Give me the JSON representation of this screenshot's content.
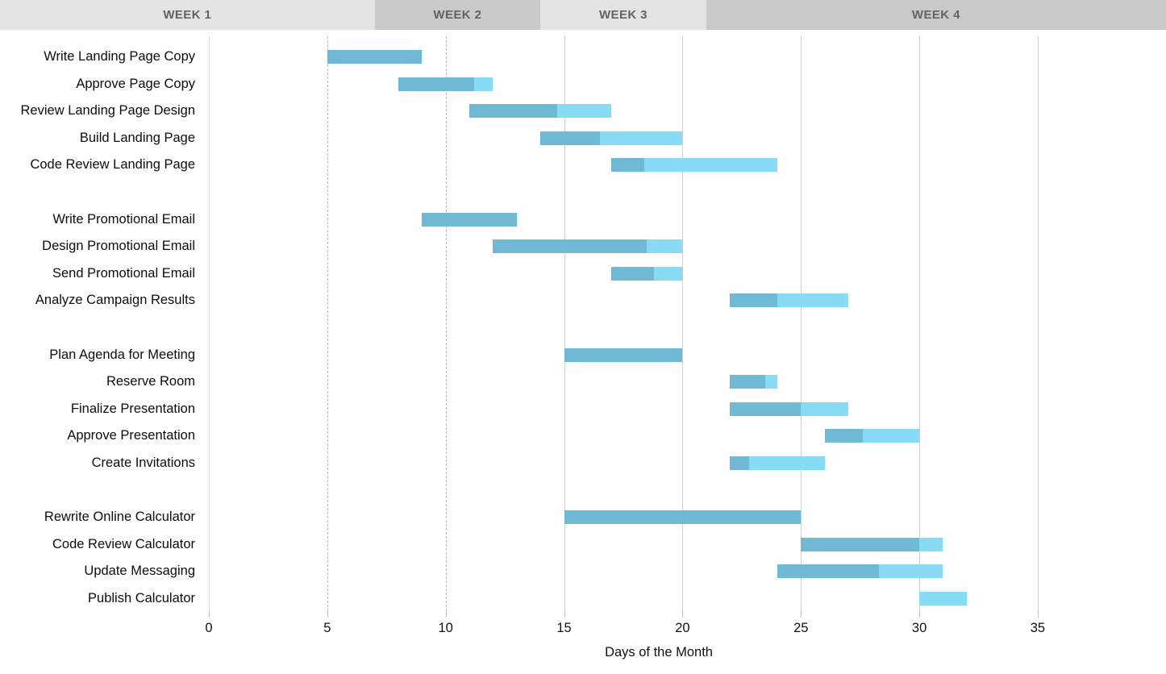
{
  "header": {
    "weeks": [
      {
        "label": "WEEK 1",
        "start_day": 0,
        "end_day": 7,
        "shade": "#e3e3e3"
      },
      {
        "label": "WEEK 2",
        "start_day": 7,
        "end_day": 14,
        "shade": "#c9c9c9"
      },
      {
        "label": "WEEK 3",
        "start_day": 14,
        "end_day": 21,
        "shade": "#e3e3e3"
      },
      {
        "label": "WEEK 4",
        "start_day": 21,
        "end_day": 28,
        "shade": "#c9c9c9"
      }
    ]
  },
  "axis": {
    "x_title": "Days of the Month",
    "x_ticks": [
      0,
      5,
      10,
      15,
      20,
      25,
      30,
      35
    ],
    "x_tick_labels": [
      "0",
      "5",
      "10",
      "15",
      "20",
      "25",
      "30",
      "35"
    ],
    "x_min": 0,
    "x_max": 38,
    "gridlines": [
      {
        "day": 5,
        "style": "dashed"
      },
      {
        "day": 10,
        "style": "dashed"
      },
      {
        "day": 15,
        "style": "solid"
      },
      {
        "day": 20,
        "style": "solid"
      },
      {
        "day": 25,
        "style": "solid"
      },
      {
        "day": 30,
        "style": "solid"
      },
      {
        "day": 35,
        "style": "solid"
      }
    ]
  },
  "colors": {
    "bar_complete": "#6FB9D4",
    "bar_remaining": "#87DBF5",
    "gridline_solid": "#d0d0d0",
    "gridline_dashed": "#bdbdbd",
    "header_band_light": "#e3e3e3",
    "header_band_dark": "#c9c9c9",
    "header_text": "#636363",
    "label_text": "#0d0d0d"
  },
  "chart_data": {
    "type": "bar",
    "title": "",
    "xlabel": "Days of the Month",
    "ylabel": "",
    "xlim": [
      0,
      38
    ],
    "grid": true,
    "legend": null,
    "orientation": "horizontal",
    "note": "Gantt chart: each task bar spans start->end in days of the month; the darker segment is elapsed/complete, the lighter segment is remaining.",
    "categories": [
      "Write Landing Page Copy",
      "Approve Page Copy",
      "Review Landing Page Design",
      "Build Landing Page",
      "Code Review Landing Page",
      "",
      "Write Promotional Email",
      "Design Promotional Email",
      "Send Promotional Email",
      "Analyze Campaign Results",
      "",
      "Plan Agenda for Meeting",
      "Reserve Room",
      "Finalize Presentation",
      "Approve Presentation",
      "Create Invitations",
      "",
      "Rewrite Online Calculator",
      "Code Review Calculator",
      "Update Messaging",
      "Publish Calculator"
    ],
    "tasks": [
      {
        "row": 0,
        "label": "Write Landing Page Copy",
        "start": 5,
        "complete_end": 9,
        "end": 9
      },
      {
        "row": 1,
        "label": "Approve Page Copy",
        "start": 8,
        "complete_end": 11.2,
        "end": 12
      },
      {
        "row": 2,
        "label": "Review Landing Page Design",
        "start": 11,
        "complete_end": 14.7,
        "end": 17
      },
      {
        "row": 3,
        "label": "Build Landing Page",
        "start": 14,
        "complete_end": 16.5,
        "end": 20
      },
      {
        "row": 4,
        "label": "Code Review Landing Page",
        "start": 17,
        "complete_end": 18.4,
        "end": 24
      },
      {
        "row": 6,
        "label": "Write Promotional Email",
        "start": 9,
        "complete_end": 13,
        "end": 13
      },
      {
        "row": 7,
        "label": "Design Promotional Email",
        "start": 12,
        "complete_end": 18.5,
        "end": 20
      },
      {
        "row": 8,
        "label": "Send Promotional Email",
        "start": 17,
        "complete_end": 18.8,
        "end": 20
      },
      {
        "row": 9,
        "label": "Analyze Campaign Results",
        "start": 22,
        "complete_end": 24,
        "end": 27
      },
      {
        "row": 11,
        "label": "Plan Agenda for Meeting",
        "start": 15,
        "complete_end": 20,
        "end": 20
      },
      {
        "row": 12,
        "label": "Reserve Room",
        "start": 22,
        "complete_end": 23.5,
        "end": 24
      },
      {
        "row": 13,
        "label": "Finalize Presentation",
        "start": 22,
        "complete_end": 25,
        "end": 27
      },
      {
        "row": 14,
        "label": "Approve Presentation",
        "start": 26,
        "complete_end": 27.6,
        "end": 30
      },
      {
        "row": 15,
        "label": "Create Invitations",
        "start": 22,
        "complete_end": 22.8,
        "end": 26
      },
      {
        "row": 17,
        "label": "Rewrite Online Calculator",
        "start": 15,
        "complete_end": 25,
        "end": 25
      },
      {
        "row": 18,
        "label": "Code Review Calculator",
        "start": 25,
        "complete_end": 30,
        "end": 31
      },
      {
        "row": 19,
        "label": "Update Messaging",
        "start": 24,
        "complete_end": 28.3,
        "end": 31
      },
      {
        "row": 20,
        "label": "Publish Calculator",
        "start": 30,
        "complete_end": 30,
        "end": 32
      }
    ]
  }
}
